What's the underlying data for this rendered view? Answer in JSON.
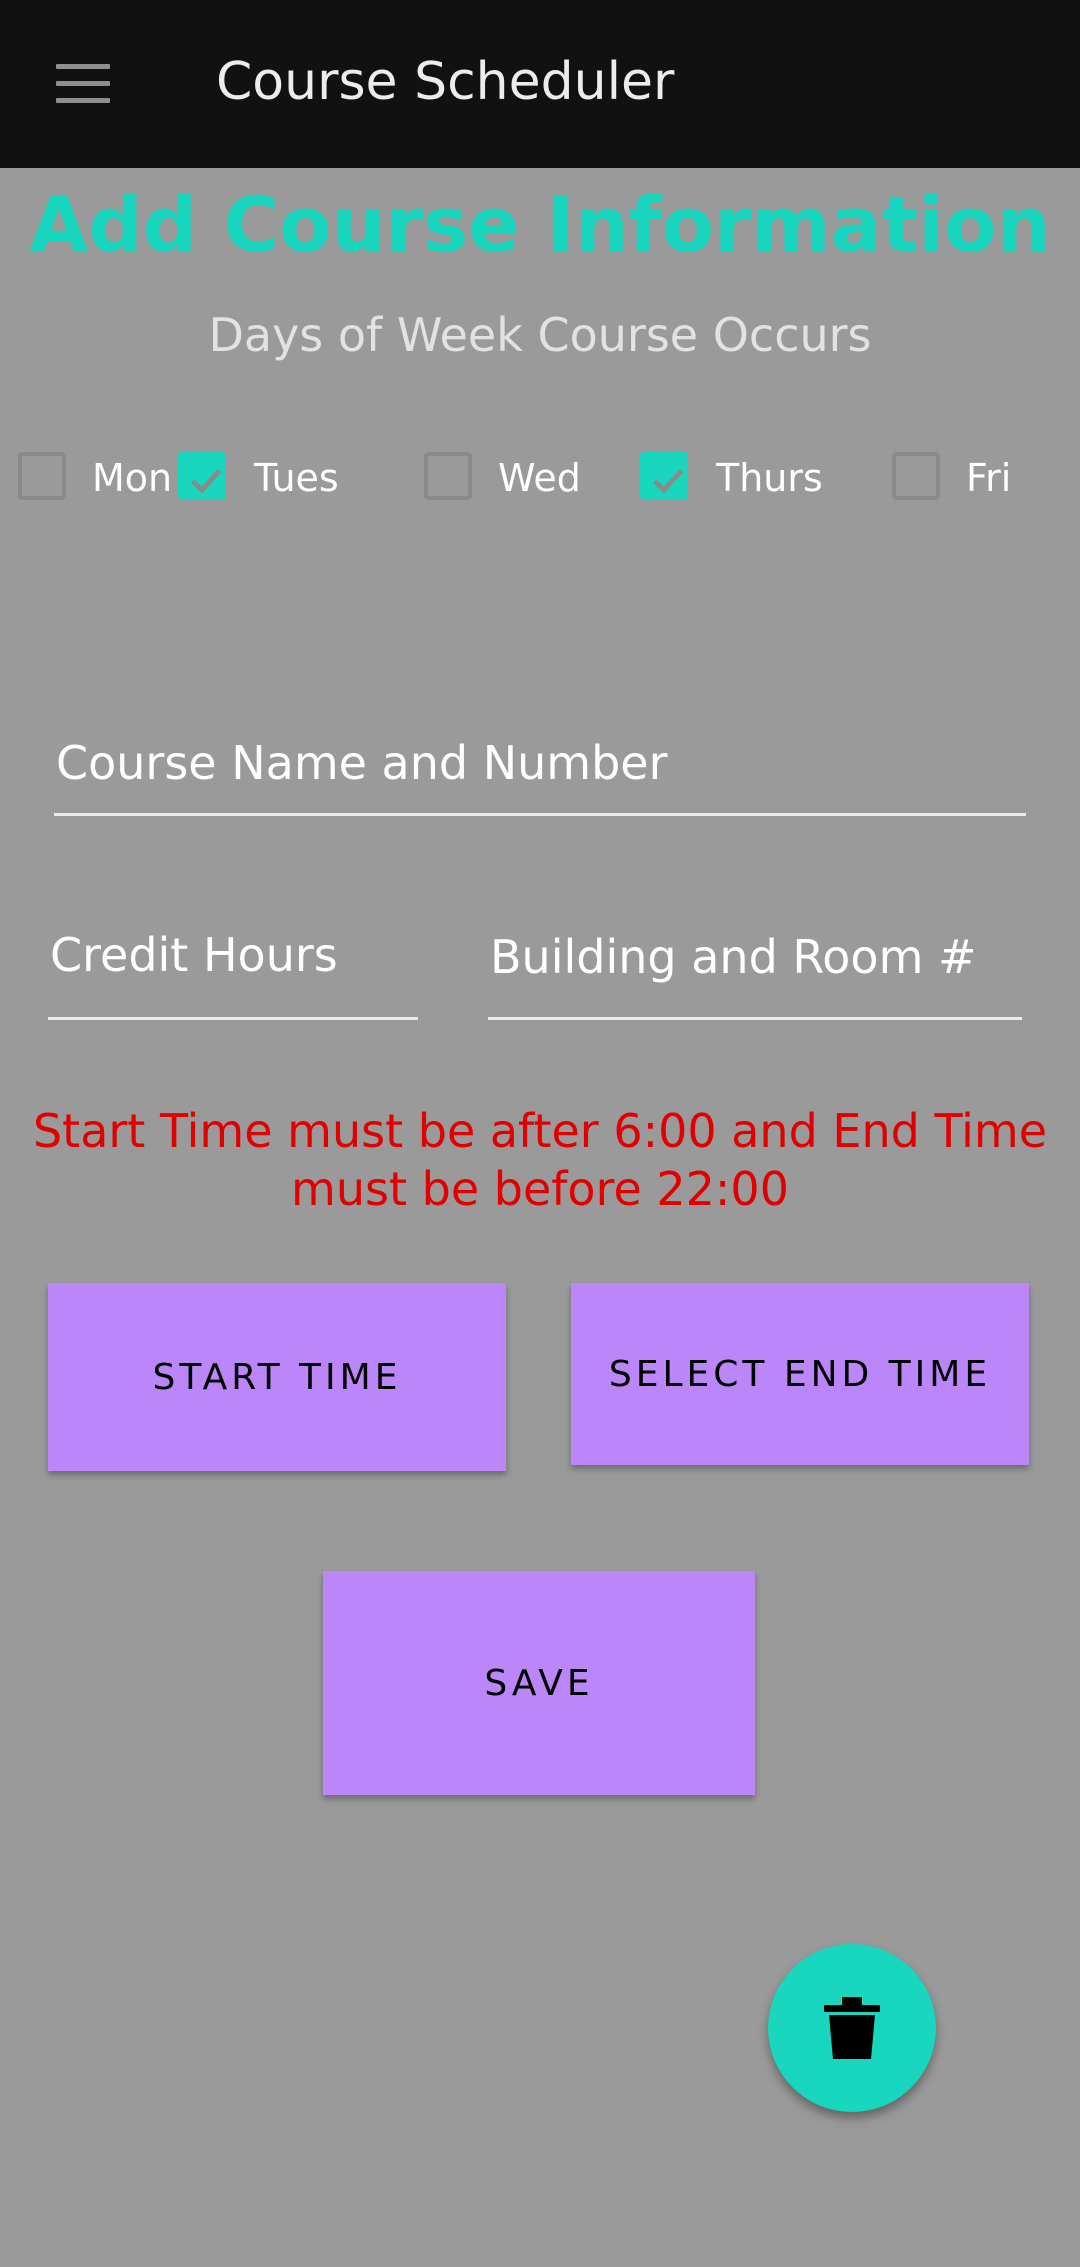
{
  "appbar": {
    "title": "Course Scheduler",
    "menu_icon": "hamburger-menu-icon"
  },
  "heading": "Add Course Information",
  "subheading": "Days of Week Course Occurs",
  "days": [
    {
      "label": "Mon",
      "checked": false
    },
    {
      "label": "Tues",
      "checked": true
    },
    {
      "label": "Wed",
      "checked": false
    },
    {
      "label": "Thurs",
      "checked": true
    },
    {
      "label": "Fri",
      "checked": false
    }
  ],
  "fields": {
    "course_name": {
      "value": "",
      "placeholder": "Course Name and Number"
    },
    "credit_hours": {
      "value": "",
      "placeholder": "Credit Hours"
    },
    "building_room": {
      "value": "",
      "placeholder": "Building and Room #"
    }
  },
  "error_message": "Start Time must be after 6:00 and End Time must be before 22:00",
  "buttons": {
    "start_time": "START TIME",
    "end_time": "SELECT END TIME",
    "save": "SAVE"
  },
  "fab": {
    "icon": "trash-icon"
  },
  "colors": {
    "accent": "#19d6be",
    "button": "#bb86f8",
    "error": "#e00000",
    "background": "#9a9a9a",
    "appbar": "#111111"
  }
}
